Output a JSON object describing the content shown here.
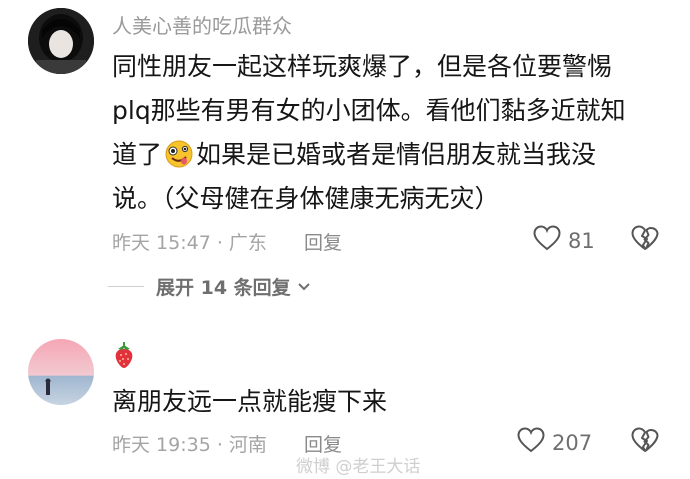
{
  "comments": [
    {
      "username": "人美心善的吃瓜群众",
      "lines": [
        "同性朋友一起这样玩爽爆了，但是各位要警惕",
        "plq那些有男有女的小团体。看他们黏多近就知"
      ],
      "line3_before_emoji": "道了",
      "emoji": "zany-face-emoji",
      "line3_after_emoji": "如果是已婚或者是情侣朋友就当我没",
      "line4": "说。（父母健在身体健康无病无灾）",
      "meta": "昨天 15:47 · 广东",
      "reply_label": "回复",
      "likes": "81"
    },
    {
      "username_icon": "strawberry-icon",
      "text": "离朋友远一点就能瘦下来",
      "meta": "昨天 19:35 · 河南",
      "reply_label": "回复",
      "likes": "207"
    }
  ],
  "expand_replies_label": "展开 14 条回复",
  "watermark": "微博 @老王大话",
  "colors": {
    "text": "#161616",
    "meta": "#a4a4a4",
    "username": "#9a9a9a"
  }
}
